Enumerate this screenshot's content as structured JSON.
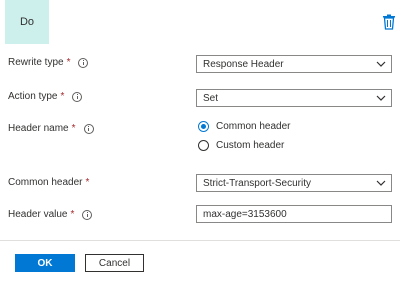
{
  "action_tile": {
    "label": "Do"
  },
  "colors": {
    "accent": "#0078d4",
    "tile_bg": "#cdf0ec",
    "required": "#a4262c"
  },
  "form": {
    "rewrite_type": {
      "label": "Rewrite type",
      "required_mark": "*",
      "value": "Response Header"
    },
    "action_type": {
      "label": "Action type",
      "required_mark": "*",
      "value": "Set"
    },
    "header_name": {
      "label": "Header name",
      "required_mark": "*",
      "options": [
        {
          "label": "Common header",
          "checked": true
        },
        {
          "label": "Custom header",
          "checked": false
        }
      ]
    },
    "common_header": {
      "label": "Common header",
      "required_mark": "*",
      "value": "Strict-Transport-Security"
    },
    "header_value": {
      "label": "Header value",
      "required_mark": "*",
      "value": "max-age=3153600"
    }
  },
  "buttons": {
    "ok": "OK",
    "cancel": "Cancel"
  },
  "icons": {
    "delete": "trash-icon",
    "info": "info-icon",
    "dropdown": "chevron-down-icon"
  }
}
